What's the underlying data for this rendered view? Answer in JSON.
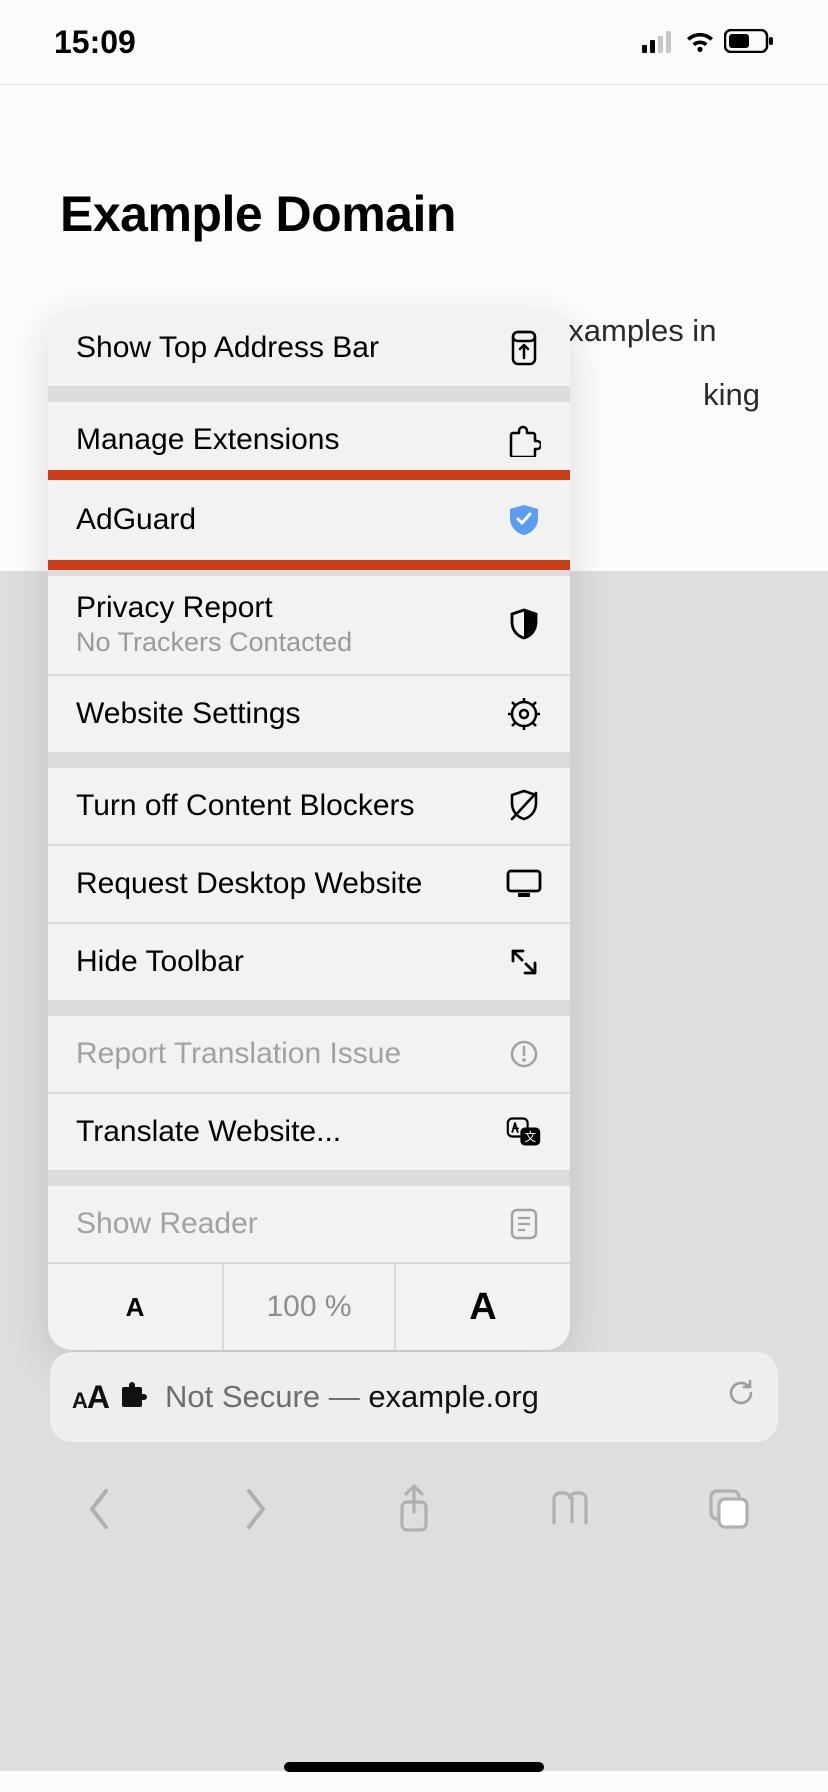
{
  "status": {
    "time": "15:09"
  },
  "page": {
    "title": "Example Domain",
    "body_visible": "This domain is for use in illustrative examples in",
    "body_tail": "king"
  },
  "menu": {
    "show_top_addr": "Show Top Address Bar",
    "manage_ext": "Manage Extensions",
    "adguard": "AdGuard",
    "privacy_report": "Privacy Report",
    "privacy_sub": "No Trackers Contacted",
    "website_settings": "Website Settings",
    "turn_off_blockers": "Turn off Content Blockers",
    "request_desktop": "Request Desktop Website",
    "hide_toolbar": "Hide Toolbar",
    "report_translation": "Report Translation Issue",
    "translate": "Translate Website...",
    "show_reader": "Show Reader",
    "zoom_small": "A",
    "zoom_pct": "100 %",
    "zoom_big": "A"
  },
  "urlbar": {
    "prefix": "Not Secure — ",
    "host": "example.org"
  }
}
